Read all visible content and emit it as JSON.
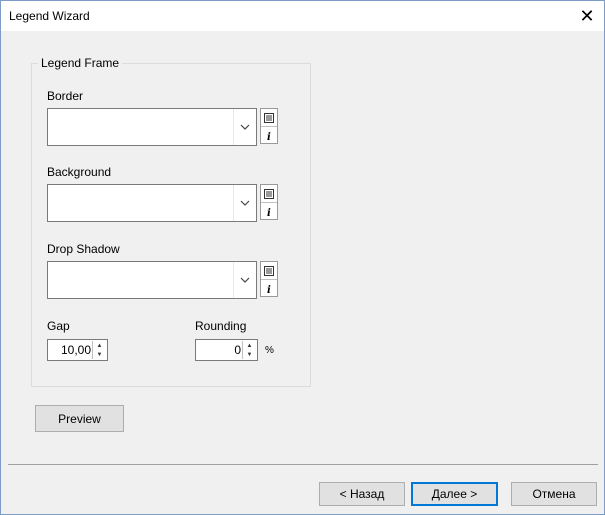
{
  "window": {
    "title": "Legend Wizard",
    "close_glyph": "✕"
  },
  "group": {
    "label": "Legend Frame"
  },
  "fields": {
    "border_label": "Border",
    "background_label": "Background",
    "drop_shadow_label": "Drop Shadow",
    "gap_label": "Gap",
    "gap_value": "10,00",
    "rounding_label": "Rounding",
    "rounding_value": "0",
    "rounding_unit": "%"
  },
  "buttons": {
    "preview": "Preview",
    "back": "< Назад",
    "next": "Далее >",
    "cancel": "Отмена"
  },
  "icons": {
    "dropdown": "chevron-down-icon",
    "properties": "properties-icon",
    "info": "info-icon",
    "spin_up": "spin-up-icon",
    "spin_down": "spin-down-icon"
  },
  "colors": {
    "accent": "#0078d7"
  }
}
